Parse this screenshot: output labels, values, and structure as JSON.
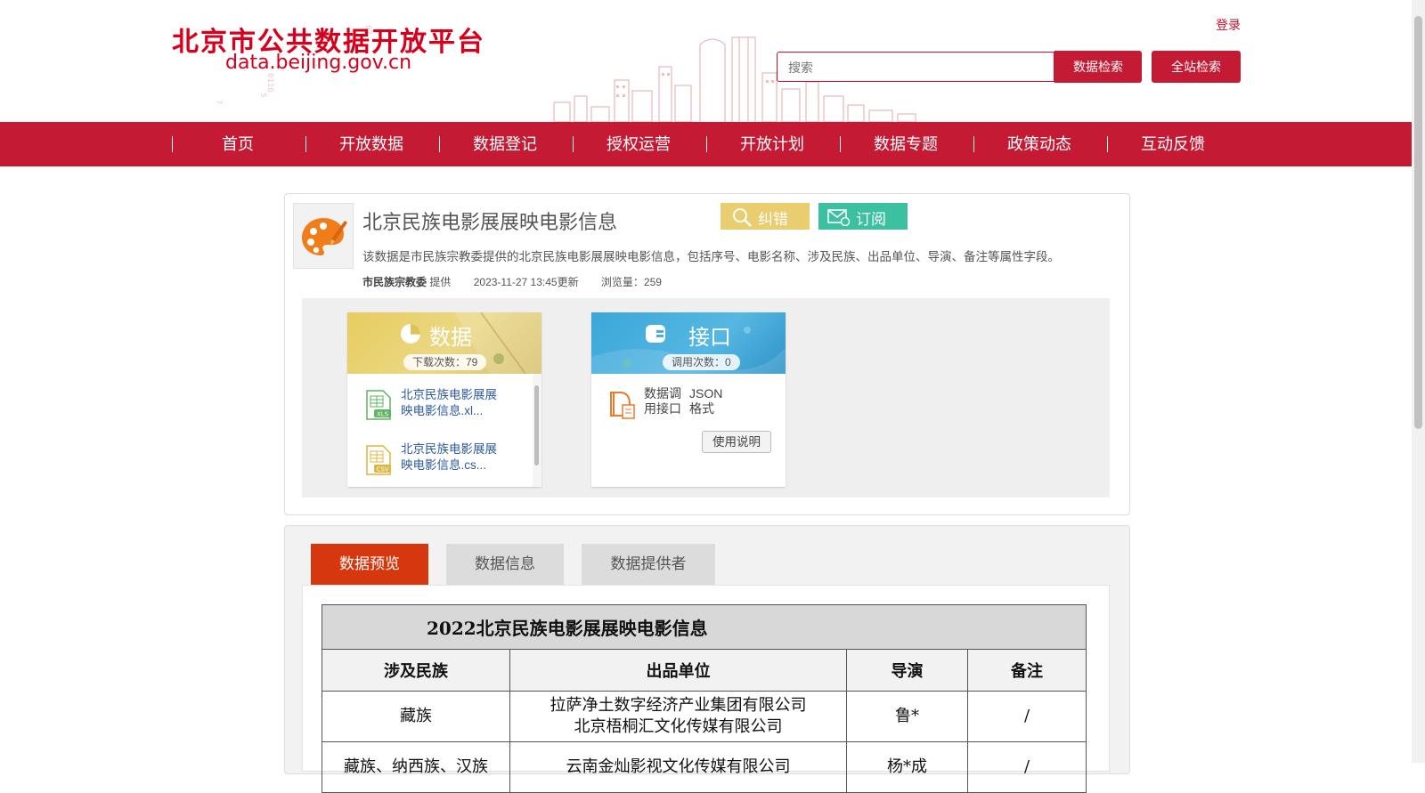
{
  "header": {
    "site_title": "北京市公共数据开放平台",
    "site_url": "data.beijing.gov.cn",
    "login": "登录",
    "search_placeholder": "搜索",
    "search_button": "数据检索",
    "site_search_button": "全站检索",
    "brand_color": "#c41a33"
  },
  "nav": [
    "首页",
    "开放数据",
    "数据登记",
    "授权运营",
    "开放计划",
    "数据专题",
    "政策动态",
    "互动反馈"
  ],
  "dataset": {
    "icon": "palette-icon",
    "title": "北京民族电影展展映电影信息",
    "error_button": "纠错",
    "subscribe_button": "订阅",
    "description": "该数据是市民族宗教委提供的北京民族电影展展映电影信息，包括序号、电影名称、涉及民族、出品单位、导演、备注等属性字段。",
    "provider": "市民族宗教委",
    "provider_suffix": "提供",
    "updated": "2023-11-27 13:45更新",
    "views": "浏览量：259"
  },
  "data_card": {
    "title": "数据",
    "downloads": "下载次数：79",
    "files": [
      {
        "type": "XLS",
        "label": "北京民族电影展展映电影信息.xl..."
      },
      {
        "type": "CSV",
        "label": "北京民族电影展展映电影信息.cs..."
      }
    ]
  },
  "api_card": {
    "title": "接口",
    "calls": "调用次数：0",
    "col1": "数据调用接口",
    "col2": "JSON格式",
    "usage_button": "使用说明"
  },
  "tabs": [
    "数据预览",
    "数据信息",
    "数据提供者"
  ],
  "preview": {
    "caption": "2022北京民族电影展展映电影信息",
    "headers": [
      "涉及民族",
      "出品单位",
      "导演",
      "备注"
    ],
    "rows": [
      {
        "nation": "藏族",
        "producer_1": "拉萨净土数字经济产业集团有限公司",
        "producer_2": "北京梧桐汇文化传媒有限公司",
        "director": "鲁*",
        "note": "/"
      },
      {
        "nation": "藏族、纳西族、汉族",
        "producer_1": "云南金灿影视文化传媒有限公司",
        "producer_2": "",
        "director": "杨*成",
        "note": "/"
      }
    ]
  }
}
